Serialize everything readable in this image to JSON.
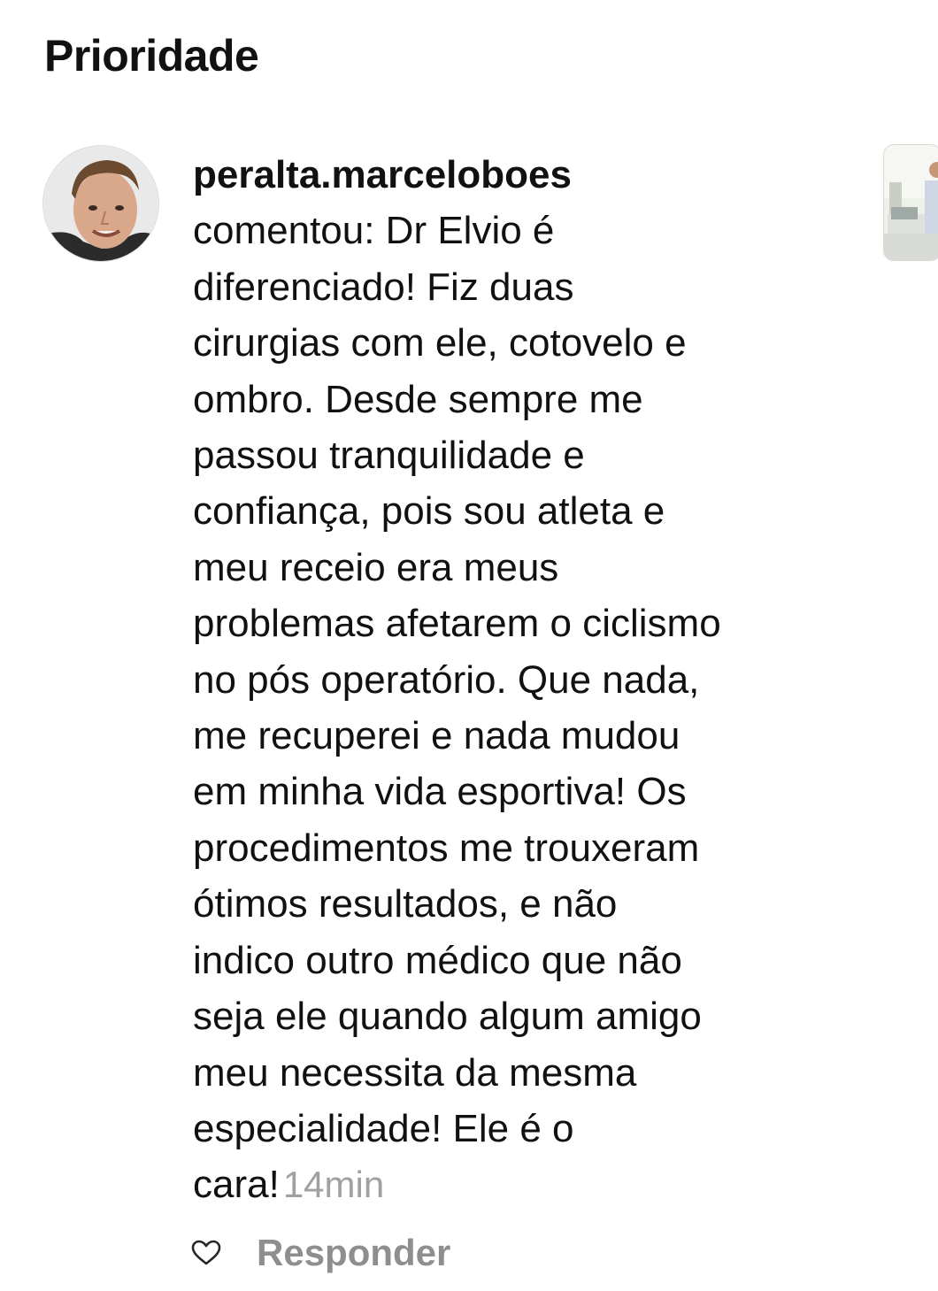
{
  "section": {
    "title": "Prioridade"
  },
  "comment": {
    "username": "peralta.marceloboes",
    "lines": [
      "comentou: Dr Elvio é",
      "diferenciado! Fiz duas",
      "cirurgias com ele, cotovelo e",
      "ombro. Desde sempre me",
      "passou tranquilidade e",
      "confiança, pois sou atleta e",
      "meu receio era meus",
      "problemas afetarem o ciclismo",
      "no pós operatório. Que nada,",
      "me recuperei e nada mudou",
      "em minha vida esportiva! Os",
      "procedimentos me trouxeram",
      "ótimos resultados, e não",
      "indico outro médico que não",
      "seja ele quando algum amigo",
      "meu necessita da mesma",
      "especialidade! Ele é o",
      "cara!"
    ],
    "timestamp": "14min"
  },
  "actions": {
    "like_icon": "heart-outline-icon",
    "reply_label": "Responder"
  },
  "colors": {
    "text": "#111111",
    "muted": "#8e8e8e",
    "timestamp": "#a0a0a0"
  }
}
